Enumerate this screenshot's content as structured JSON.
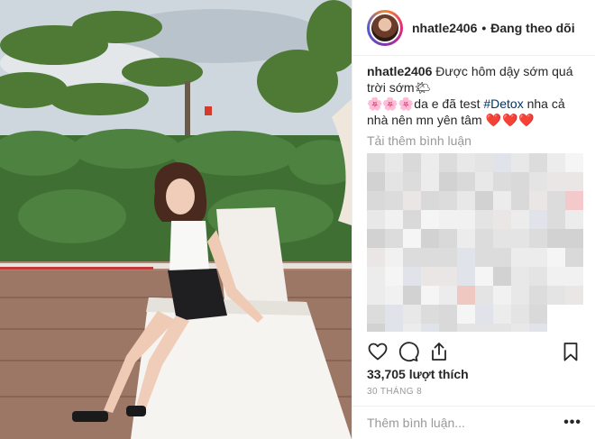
{
  "header": {
    "username": "nhatle2406",
    "separator": "•",
    "follow_status": "Đang theo dõi"
  },
  "caption": {
    "username": "nhatle2406",
    "text_1": "Được hôm dậy sớm quá trời sớm",
    "emoji_sun": "🌤",
    "flowers": "🌸🌸🌸",
    "text_2": "da e đã test ",
    "hashtag": "#Detox",
    "text_3": " nha cả nhà nên mn yên tâm ",
    "hearts": "❤️❤️❤️"
  },
  "load_more_label": "Tải thêm bình luận",
  "actions": {
    "like_icon": "heart-outline-icon",
    "comment_icon": "speech-bubble-icon",
    "share_icon": "share-upload-icon",
    "save_icon": "bookmark-icon"
  },
  "likes_text": "33,705 lượt thích",
  "date_text": "30 THÁNG 8",
  "add_comment": {
    "placeholder": "Thêm bình luận...",
    "more_label": "•••"
  },
  "colors": {
    "text": "#262626",
    "muted": "#999999",
    "hashtag": "#003569",
    "heart": "#e0245e"
  }
}
